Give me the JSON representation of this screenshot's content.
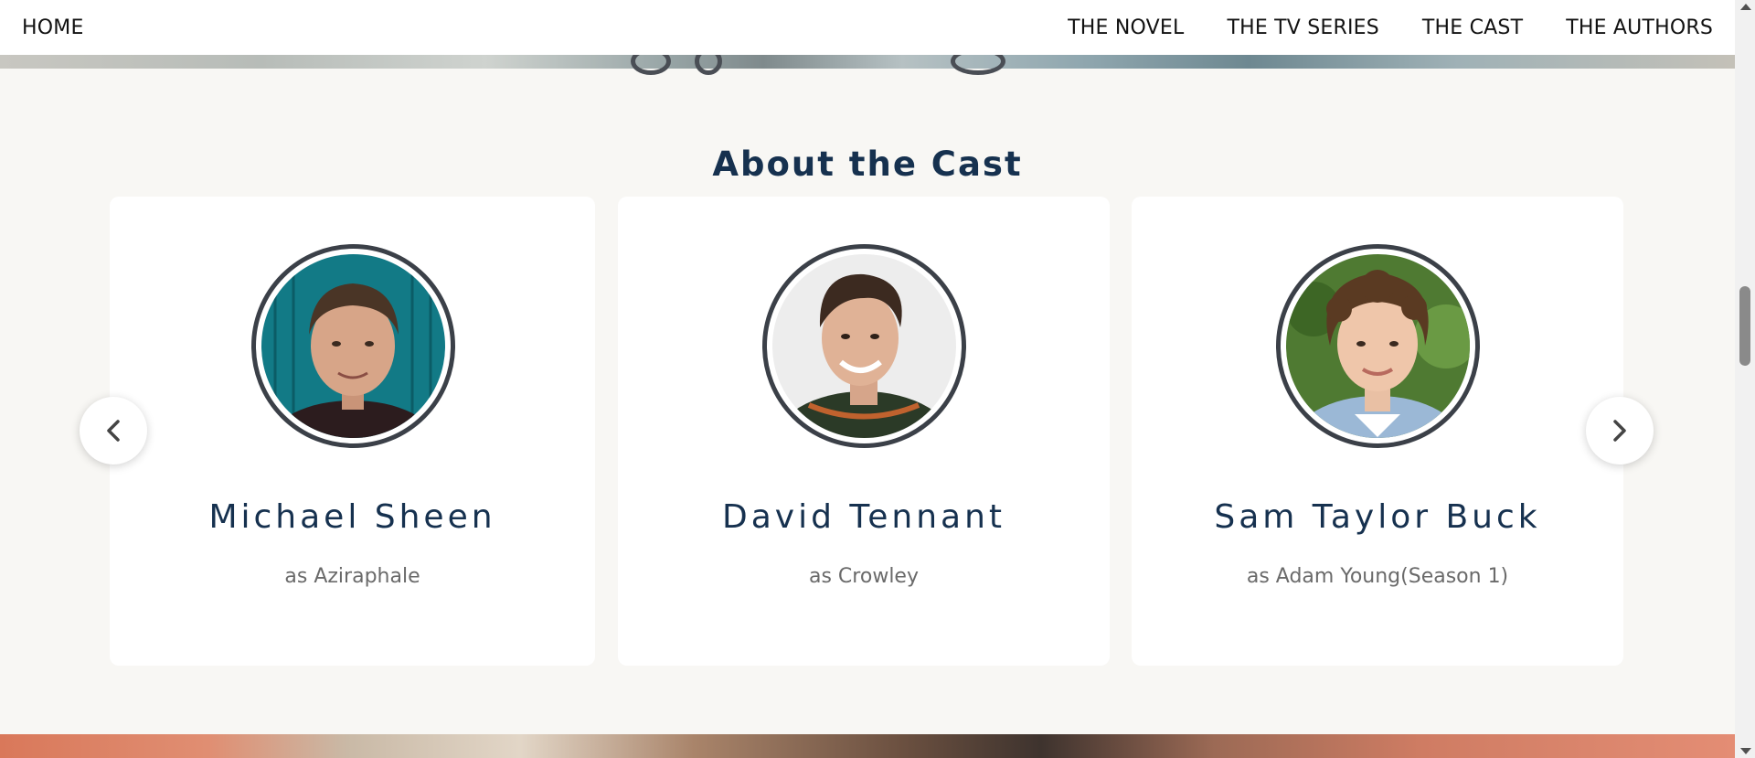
{
  "nav": {
    "home": "HOME",
    "items": [
      "THE NOVEL",
      "THE TV SERIES",
      "THE CAST",
      "THE AUTHORS"
    ]
  },
  "section": {
    "title": "About the Cast"
  },
  "cast": [
    {
      "name": "Michael Sheen",
      "role": "as Aziraphale"
    },
    {
      "name": "David Tennant",
      "role": "as Crowley"
    },
    {
      "name": "Sam Taylor Buck",
      "role": "as Adam Young(Season 1)"
    }
  ],
  "carousel": {
    "prev_icon": "chevron-left-icon",
    "next_icon": "chevron-right-icon"
  },
  "colors": {
    "title": "#16314f",
    "role_text": "#6a6a6a",
    "page_bg": "#f8f7f4",
    "avatar_border": "#3b4048"
  }
}
